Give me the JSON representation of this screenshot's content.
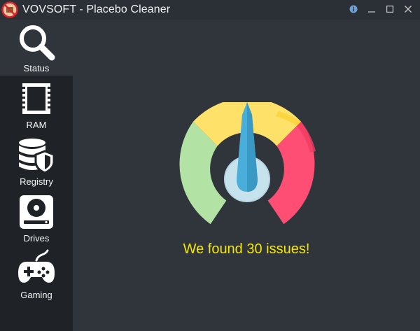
{
  "window": {
    "title": "VOVSOFT - Placebo Cleaner",
    "controls": [
      "info-icon",
      "minimize-icon",
      "maximize-icon",
      "close-icon"
    ]
  },
  "sidebar": {
    "items": [
      {
        "label": "Status",
        "icon": "magnifier-icon",
        "active": true
      },
      {
        "label": "RAM",
        "icon": "memory-chip-icon",
        "active": false
      },
      {
        "label": "Registry",
        "icon": "database-shield-icon",
        "active": false
      },
      {
        "label": "Drives",
        "icon": "hard-drive-icon",
        "active": false
      },
      {
        "label": "Gaming",
        "icon": "gamepad-icon",
        "active": false
      }
    ]
  },
  "main": {
    "gauge": {
      "colors": {
        "green": "#b3e2a5",
        "yellow": "#fde168",
        "red": "#ff4e73",
        "needle": "#4aaedb",
        "hub": "#c6e3ed"
      }
    },
    "result_text": "We found 30 issues!"
  },
  "colors": {
    "titlebar": "#2b3036",
    "sidebar": "#1f2327",
    "main": "#30353b",
    "result_text": "#f5e600"
  }
}
